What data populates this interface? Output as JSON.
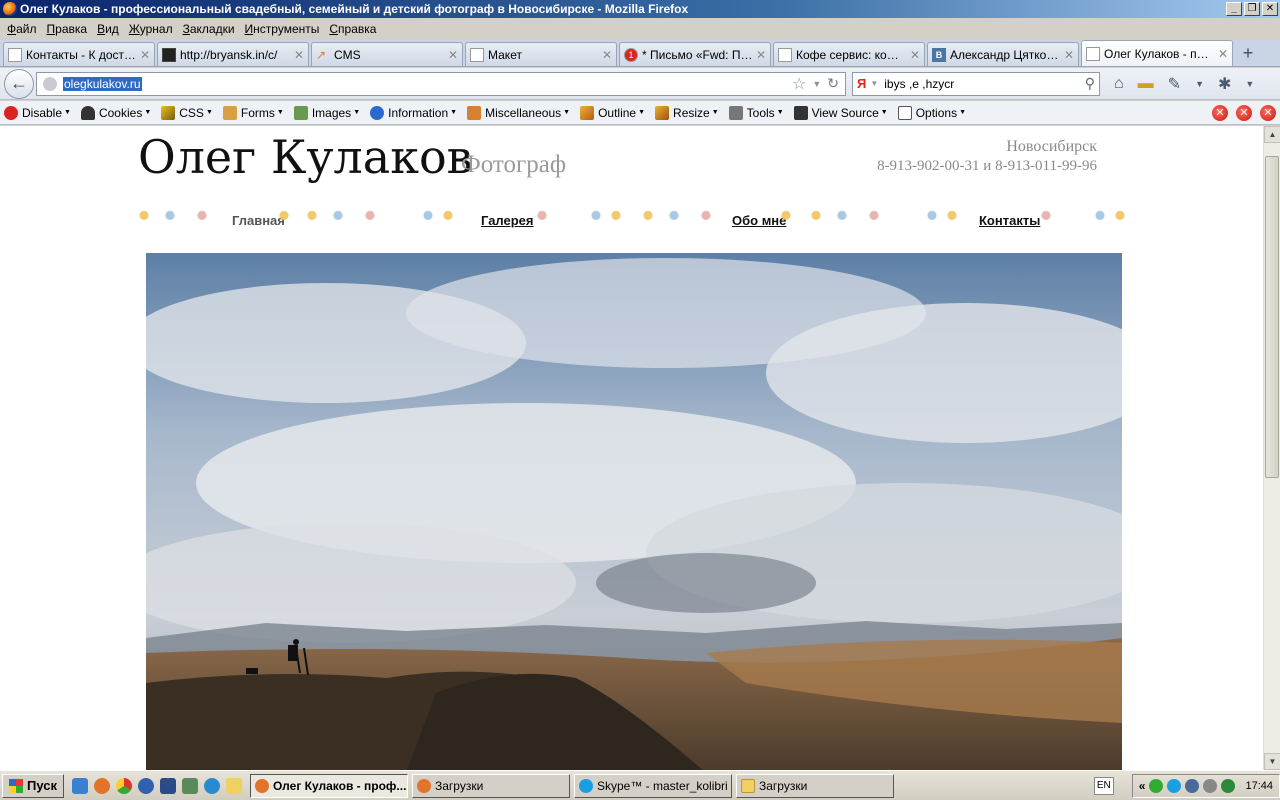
{
  "window": {
    "title": "Олег Кулаков - профессиональный свадебный, семейный и детский фотограф в Новосибирске - Mozilla Firefox",
    "controls": [
      "_",
      "❐",
      "✕"
    ]
  },
  "menu": [
    "Файл",
    "Правка",
    "Вид",
    "Журнал",
    "Закладки",
    "Инструменты",
    "Справка"
  ],
  "tabs": [
    {
      "label": "Контакты - К доста...",
      "favicon": "blank-page-icon"
    },
    {
      "label": "http://bryansk.in/c/",
      "favicon": "dark-site-icon"
    },
    {
      "label": "CMS",
      "favicon": "cms-icon"
    },
    {
      "label": "Макет",
      "favicon": "blank-page-icon"
    },
    {
      "label": "* Письмо «Fwd: По п...",
      "favicon": "mail-icon",
      "badge": "1"
    },
    {
      "label": "Кофе сервис: кофе ...",
      "favicon": "blank-page-icon"
    },
    {
      "label": "Александр Цятковс...",
      "favicon": "vk-icon",
      "badge": "B"
    },
    {
      "label": "Олег Кулаков - про...",
      "favicon": "camera-icon",
      "active": true
    }
  ],
  "nav": {
    "url": "olegkulakov.ru",
    "search_engine": "Я",
    "search_query": "ibys ,e ,hzycr"
  },
  "devtoolbar": {
    "items": [
      "Disable",
      "Cookies",
      "CSS",
      "Forms",
      "Images",
      "Information",
      "Miscellaneous",
      "Outline",
      "Resize",
      "Tools",
      "View Source",
      "Options"
    ]
  },
  "site": {
    "title": "Олег Кулаков",
    "subtitle": "Фотограф",
    "city": "Новосибирск",
    "phones": "8-913-902-00-31 и 8-913-011-99-96",
    "nav": [
      {
        "label": "Главная",
        "current": true
      },
      {
        "label": "Галерея"
      },
      {
        "label": "Обо мне"
      },
      {
        "label": "Контакты"
      }
    ]
  },
  "taskbar": {
    "start": "Пуск",
    "tasks": [
      {
        "label": "Олег Кулаков - проф...",
        "active": true
      },
      {
        "label": "Загрузки"
      },
      {
        "label": "Skype™ - master_kolibri"
      },
      {
        "label": "Загрузки"
      }
    ],
    "lang": "EN",
    "clock": "17:44"
  },
  "colors": {
    "accent": "#316ac5",
    "title_bar": "#0a246a",
    "close_red": "#c81a10"
  }
}
